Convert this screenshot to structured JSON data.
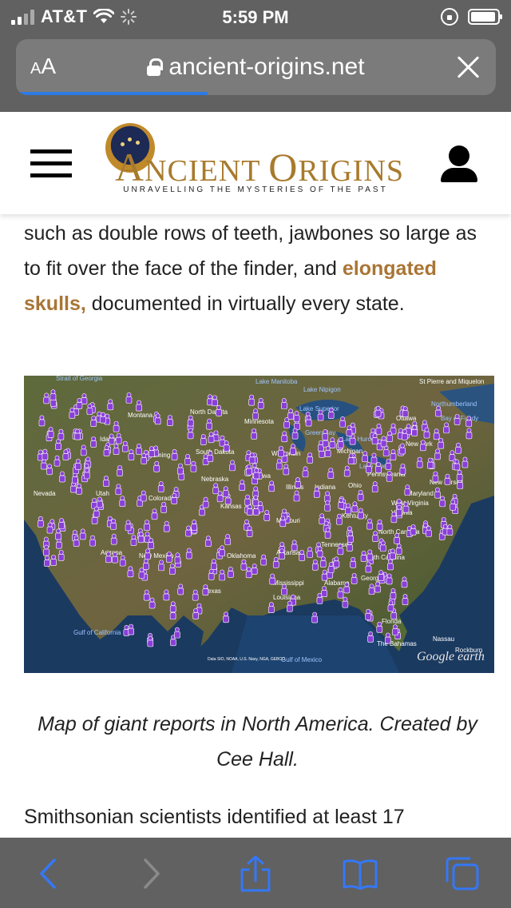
{
  "status_bar": {
    "carrier": "AT&T",
    "time": "5:59 PM"
  },
  "url_bar": {
    "reader_label_small": "A",
    "reader_label_large": "A",
    "domain": "ancient-origins.net",
    "load_progress_fraction": 0.4
  },
  "site_header": {
    "logo_word1_cap": "A",
    "logo_word1_rest": "NCIENT",
    "logo_word2_cap": "O",
    "logo_word2_rest": "RIGINS",
    "tagline": "UNRAVELLING THE MYSTERIES OF THE PAST"
  },
  "article": {
    "para1_part1": "such as double rows of teeth, jawbones so large as to fit over the face of the finder, and",
    "para1_link": "elongated skulls,",
    "para1_part2": "documented in virtually every state.",
    "map_labels": {
      "montana": "Montana",
      "north_dakota": "North Dakota",
      "minnesota": "Minnesota",
      "wyoming": "Wyoming",
      "south_dakota": "South Dakota",
      "wisconsin": "Wisconsin",
      "michigan": "Michigan",
      "idaho": "Idaho",
      "nevada": "Nevada",
      "utah": "Utah",
      "colorado": "Colorado",
      "nebraska": "Nebraska",
      "iowa": "Iowa",
      "kansas": "Kansas",
      "missouri": "Missouri",
      "illinois": "Illinois",
      "indiana": "Indiana",
      "ohio": "Ohio",
      "pennsylvania": "Pennsylvania",
      "new_york": "New York",
      "new_jersey": "New Jersey",
      "maryland": "Maryland",
      "west_virginia": "West Virginia",
      "virginia": "Virginia",
      "kentucky": "Kentucky",
      "tennessee": "Tennessee",
      "north_carolina": "North Carolina",
      "south_carolina": "South Carolina",
      "arizona": "Arizona",
      "new_mexico": "New Mexico",
      "oklahoma": "Oklahoma",
      "arkansas": "Arkansas",
      "texas": "Texas",
      "mississippi": "Mississippi",
      "alabama": "Alabama",
      "georgia": "Georgia",
      "louisiana": "Louisiana",
      "florida": "Florida",
      "lake_manitoba": "Lake Manitoba",
      "lake_nipigon": "Lake Nipigon",
      "lake_superior": "Lake Superior",
      "green_bay": "Green Bay",
      "lake_huron": "Lake Huron",
      "lake_erie": "Lake Erie",
      "ottawa": "Ottawa",
      "bay_of_fundy": "Bay of Fundy",
      "strait_of_georgia": "Strait of Georgia",
      "st_pierre": "St Pierre and Miquelon",
      "northumberland": "Northumberland",
      "gulf_of_california": "Gulf of California",
      "gulf_of_mexico": "Gulf of Mexico",
      "the_bahamas": "The Bahamas",
      "nassau": "Nassau",
      "rockburn": "Rockburn",
      "google_earth": "Google earth",
      "data_credit": "Data SIO, NOAA, U.S. Navy, NGA, GEBCO"
    },
    "caption": "Map of giant reports in North America. Created by Cee Hall.",
    "para2": "Smithsonian scientists identified at least 17"
  },
  "colors": {
    "chrome_gray": "#616161",
    "accent_blue": "#3478f6",
    "link_gold": "#a97535",
    "marker_purple": "#8a3fd8"
  }
}
